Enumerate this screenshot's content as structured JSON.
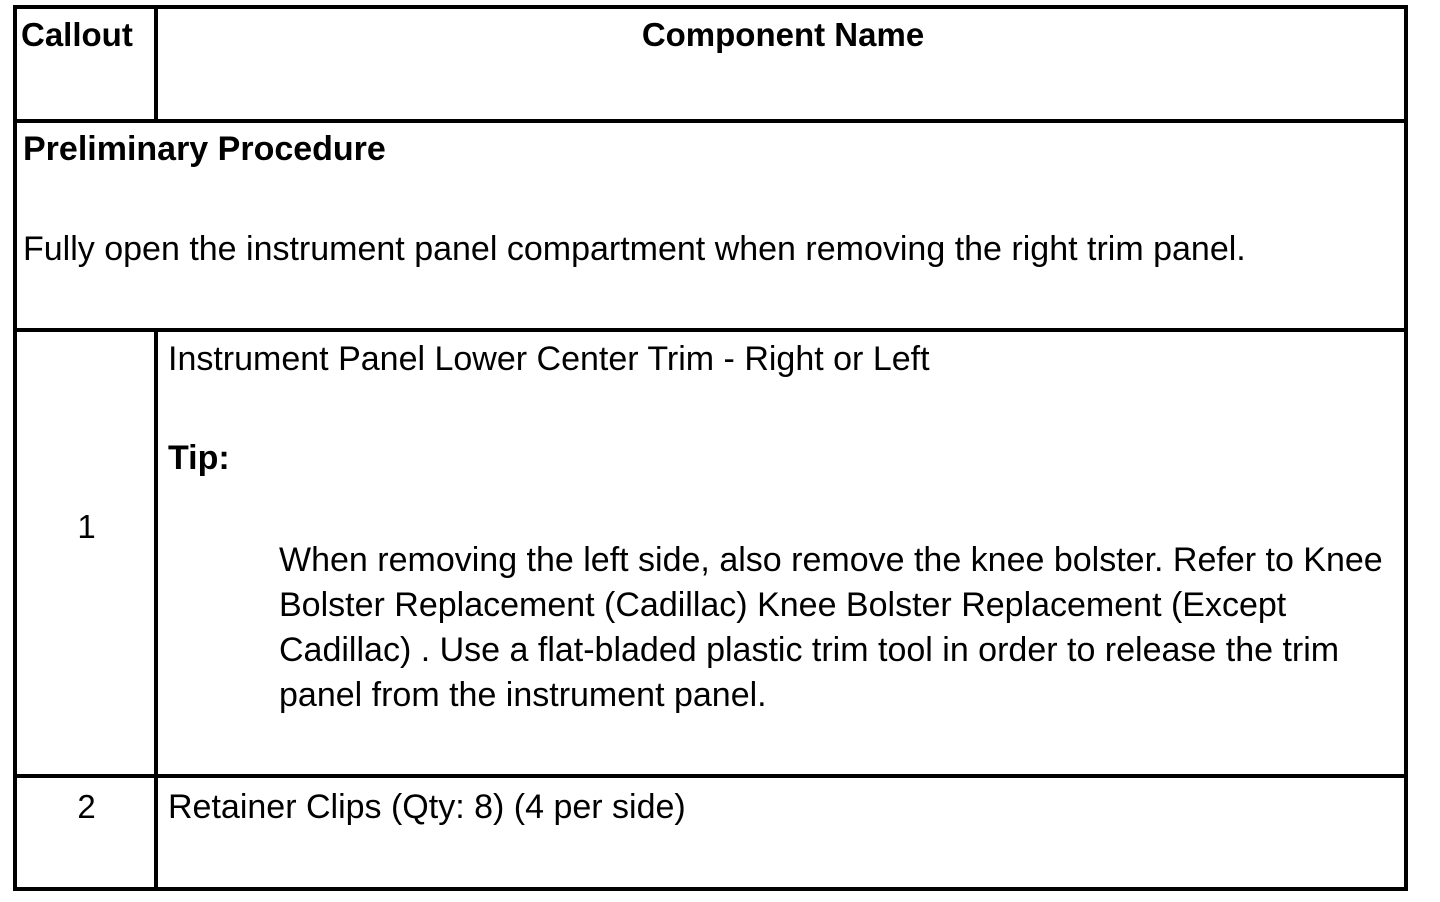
{
  "table": {
    "header": {
      "callout": "Callout",
      "component_name": "Component Name"
    },
    "preliminary": {
      "title": "Preliminary Procedure",
      "text": "Fully open the instrument panel compartment when removing the right trim panel."
    },
    "rows": [
      {
        "callout": "1",
        "component": "Instrument Panel Lower Center Trim - Right or Left",
        "tip_label": "Tip:",
        "tip_text": "When removing the left side, also remove the knee bolster. Refer to Knee Bolster Replacement (Cadillac) Knee Bolster Replacement (Except Cadillac) . Use a flat-bladed plastic trim tool in order to release the trim panel from the instrument panel."
      },
      {
        "callout": "2",
        "component": "Retainer Clips (Qty: 8) (4 per side)"
      }
    ]
  }
}
